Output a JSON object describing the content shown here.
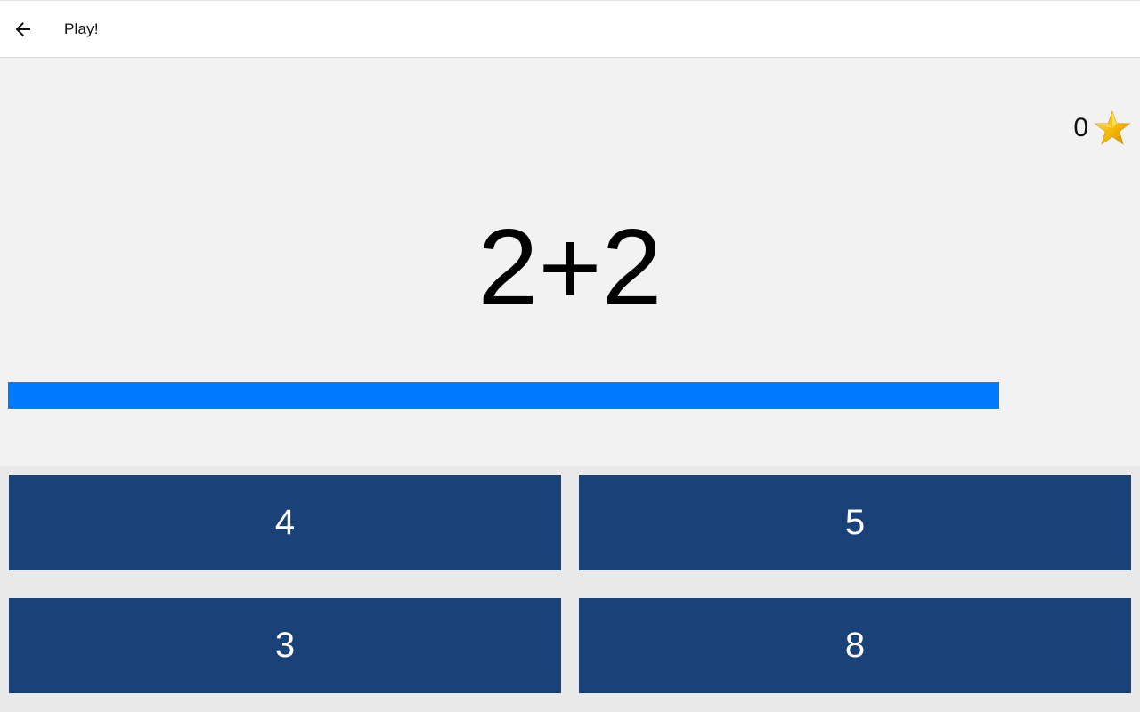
{
  "header": {
    "title": "Play!",
    "back_icon": "arrow-left-icon"
  },
  "score": {
    "value": "0",
    "icon": "star-icon"
  },
  "question": "2+2",
  "timer": {
    "remaining_fraction": 0.882,
    "color": "#007aff"
  },
  "answers": [
    "4",
    "5",
    "3",
    "8"
  ],
  "colors": {
    "answer_button": "#1b4179",
    "game_background": "#f2f2f2"
  }
}
